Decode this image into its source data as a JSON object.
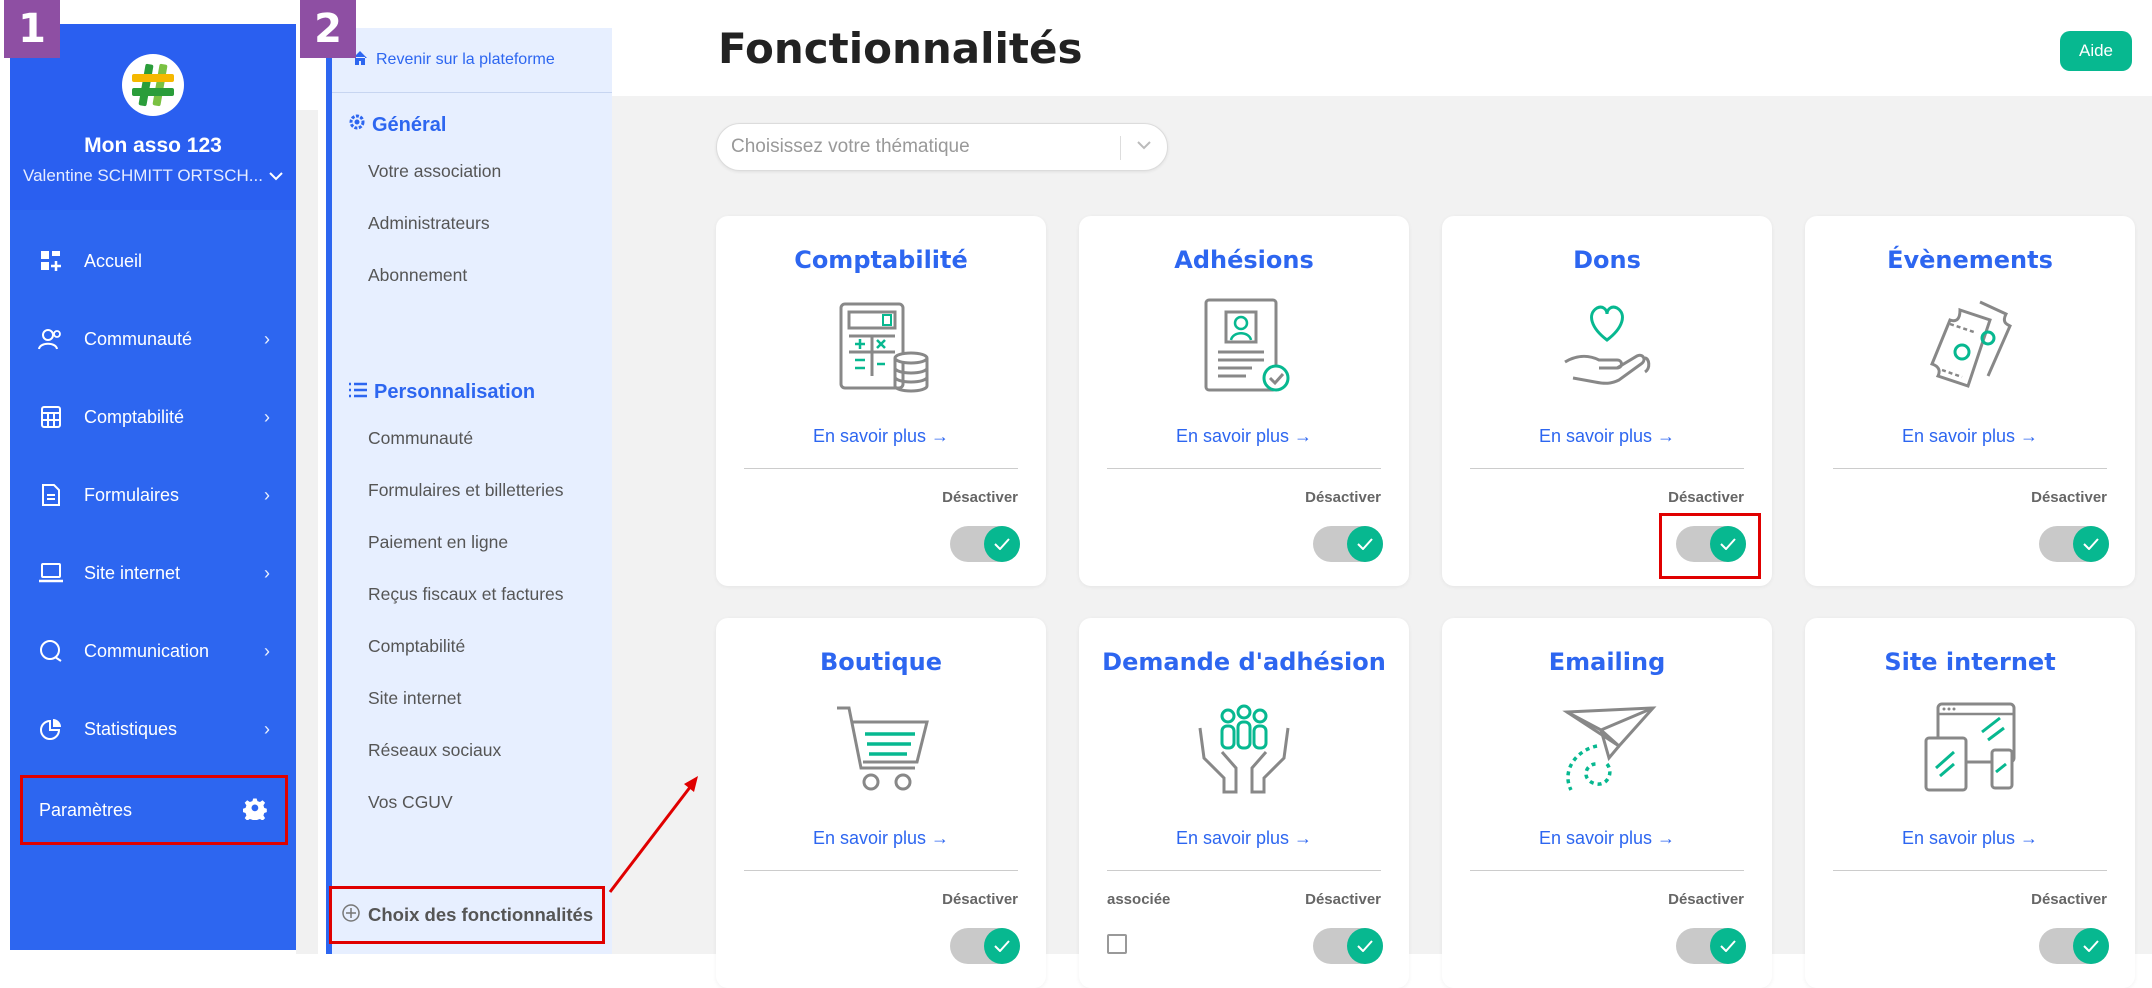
{
  "markers": [
    "1",
    "2"
  ],
  "sidebar": {
    "org_name": "Mon asso 123",
    "user_name": "Valentine SCHMITT ORTSCH...",
    "items": [
      {
        "label": "Accueil",
        "icon": "dashboard-icon"
      },
      {
        "label": "Communauté",
        "icon": "users-icon"
      },
      {
        "label": "Comptabilité",
        "icon": "calculator-icon"
      },
      {
        "label": "Formulaires",
        "icon": "document-icon"
      },
      {
        "label": "Site internet",
        "icon": "laptop-icon"
      },
      {
        "label": "Communication",
        "icon": "chat-icon"
      },
      {
        "label": "Statistiques",
        "icon": "pie-chart-icon"
      }
    ],
    "settings_label": "Paramètres"
  },
  "settings_nav": {
    "back_label": "Revenir sur la plateforme",
    "general": {
      "title": "Général",
      "items": [
        "Votre association",
        "Administrateurs",
        "Abonnement"
      ]
    },
    "custom": {
      "title": "Personnalisation",
      "items": [
        "Communauté",
        "Formulaires et billetteries",
        "Paiement en ligne",
        "Reçus fiscaux et factures",
        "Comptabilité",
        "Site internet",
        "Réseaux sociaux",
        "Vos CGUV"
      ]
    },
    "features_label": "Choix des fonctionnalités"
  },
  "main": {
    "title": "Fonctionnalités",
    "help_label": "Aide",
    "theme_placeholder": "Choisissez votre thématique",
    "more_label": "En savoir plus",
    "deactivate_label": "Désactiver",
    "cards": [
      {
        "title": "Comptabilité",
        "enabled": true
      },
      {
        "title": "Adhésions",
        "enabled": true
      },
      {
        "title": "Dons",
        "enabled": true
      },
      {
        "title": "Évènements",
        "enabled": true
      },
      {
        "title": "Boutique",
        "enabled": true
      },
      {
        "title": "Demande d'adhésion",
        "enabled": true,
        "extra_label": "associée"
      },
      {
        "title": "Emailing",
        "enabled": true
      },
      {
        "title": "Site internet",
        "enabled": true
      }
    ]
  },
  "colors": {
    "primary": "#2d66f0",
    "accent": "#07b890",
    "highlight": "#e00000",
    "marker": "#8e4fa3"
  }
}
